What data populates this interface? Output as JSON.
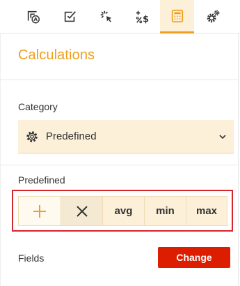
{
  "toolbar": {
    "tools": [
      {
        "icon": "format-icon"
      },
      {
        "icon": "checkbox-icon"
      },
      {
        "icon": "click-icon"
      },
      {
        "icon": "percent-dollar-icon"
      },
      {
        "icon": "calculator-icon",
        "active": true
      },
      {
        "icon": "gears-icon"
      }
    ]
  },
  "panel": {
    "title": "Calculations",
    "category": {
      "label": "Category",
      "value": "Predefined"
    },
    "predefined": {
      "label": "Predefined",
      "buttons": [
        {
          "icon": "plus-icon",
          "label": ""
        },
        {
          "icon": "close-icon",
          "label": ""
        },
        {
          "label": "avg"
        },
        {
          "label": "min"
        },
        {
          "label": "max"
        }
      ]
    },
    "fields": {
      "label": "Fields",
      "change_label": "Change"
    }
  },
  "colors": {
    "accent": "#f0a01c",
    "input_bg": "#fcf0d9",
    "highlight": "#d8242b",
    "change_button": "#dc1d00"
  }
}
